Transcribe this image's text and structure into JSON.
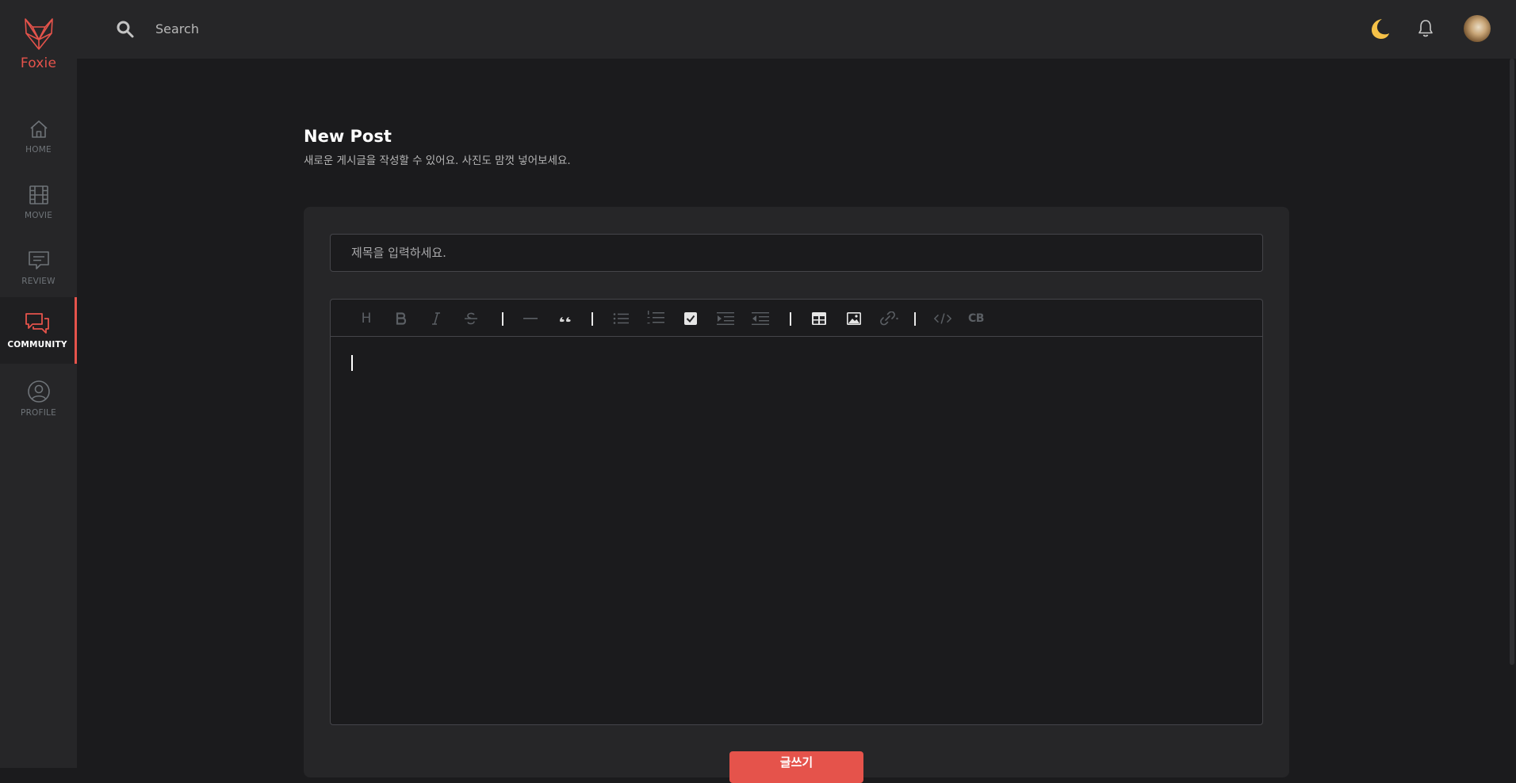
{
  "app": {
    "name": "Foxie",
    "brand_color": "#e5534b"
  },
  "sidebar": {
    "items": [
      {
        "label": "HOME",
        "icon": "home-icon",
        "active": false
      },
      {
        "label": "MOVIE",
        "icon": "film-icon",
        "active": false
      },
      {
        "label": "REVIEW",
        "icon": "review-icon",
        "active": false
      },
      {
        "label": "COMMUNITY",
        "icon": "chat-icon",
        "active": true
      },
      {
        "label": "PROFILE",
        "icon": "user-icon",
        "active": false
      }
    ]
  },
  "topbar": {
    "search_placeholder": "Search",
    "icons": [
      "moon-icon",
      "bell-icon",
      "avatar"
    ]
  },
  "page": {
    "title": "New Post",
    "subtitle": "새로운 게시글을 작성할 수 있어요. 사진도 맘껏 넣어보세요."
  },
  "form": {
    "title_placeholder": "제목을 입력하세요.",
    "toolbar": {
      "heading": "H",
      "code_block": "CB",
      "tools": [
        "heading-icon",
        "bold-icon",
        "italic-icon",
        "strike-icon",
        "hr-icon",
        "quote-icon",
        "bullet-list-icon",
        "ordered-list-icon",
        "task-list-icon",
        "indent-icon",
        "outdent-icon",
        "table-icon",
        "image-icon",
        "link-icon",
        "code-icon",
        "code-block-icon"
      ]
    },
    "submit_label": "글쓰기"
  }
}
